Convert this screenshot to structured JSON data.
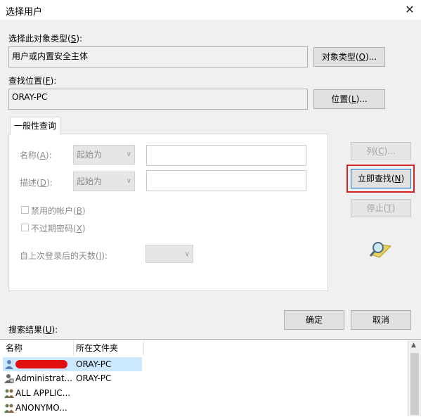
{
  "window": {
    "title": "选择用户",
    "close_glyph": "✕"
  },
  "object_type": {
    "label": "选择此对象类型(",
    "hotkey": "S",
    "label_end": "):",
    "value": "用户或内置安全主体",
    "button": "对象类型(",
    "button_hotkey": "O",
    "button_end": ")..."
  },
  "location": {
    "label": "查找位置(",
    "hotkey": "F",
    "label_end": "):",
    "value": "ORAY-PC",
    "button": "位置(",
    "button_hotkey": "L",
    "button_end": ")..."
  },
  "tab": {
    "label": "一般性查询"
  },
  "query": {
    "name_label": "名称(",
    "name_hotkey": "A",
    "name_end": "):",
    "name_mode": "起始为",
    "name_value": "",
    "desc_label": "描述(",
    "desc_hotkey": "D",
    "desc_end": "):",
    "desc_mode": "起始为",
    "desc_value": "",
    "disabled_accounts": "禁用的帐户(",
    "disabled_accounts_hotkey": "B",
    "disabled_accounts_end": ")",
    "no_expire": "不过期密码(",
    "no_expire_hotkey": "X",
    "no_expire_end": ")",
    "days_label": "自上次登录后的天数(",
    "days_hotkey": "I",
    "days_end": "):",
    "days_value": ""
  },
  "side_buttons": {
    "columns": "列(",
    "columns_hotkey": "C",
    "columns_end": ")...",
    "find_now": "立即查找(",
    "find_now_hotkey": "N",
    "find_now_end": ")",
    "stop": "停止(",
    "stop_hotkey": "T",
    "stop_end": ")"
  },
  "actions": {
    "ok": "确定",
    "cancel": "取消"
  },
  "results": {
    "label": "搜索结果(",
    "hotkey": "U",
    "label_end": "):",
    "columns": [
      "名称",
      "所在文件夹"
    ],
    "rows": [
      {
        "name": "",
        "folder": "ORAY-PC",
        "redacted": true,
        "selected": true
      },
      {
        "name": "Administrat...",
        "folder": "ORAY-PC"
      },
      {
        "name": "ALL APPLIC...",
        "folder": ""
      },
      {
        "name": "ANONYMO...",
        "folder": ""
      }
    ]
  },
  "colors": {
    "highlight_border": "#d22424",
    "selection": "#cce8ff",
    "redaction": "#e01010"
  }
}
